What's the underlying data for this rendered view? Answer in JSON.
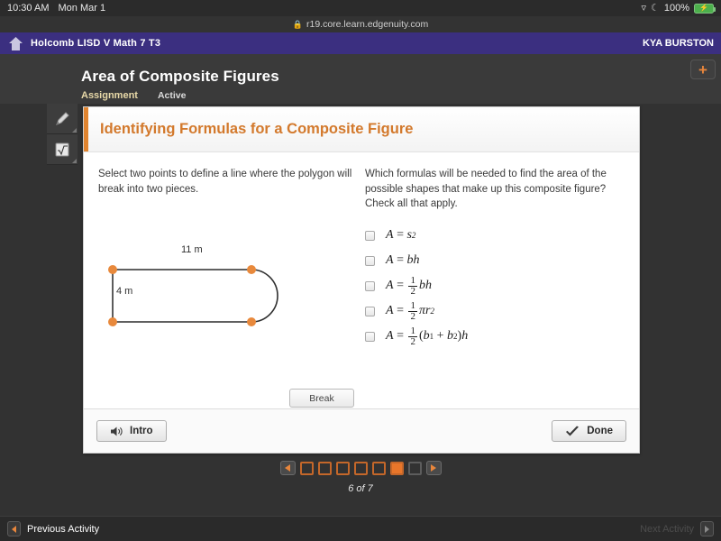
{
  "status_bar": {
    "time": "10:30 AM",
    "date": "Mon Mar 1",
    "wifi_icon": "wifi-icon",
    "dnd_icon": "moon-icon",
    "battery_percent": "100%",
    "battery_icon": "battery-charging-icon"
  },
  "browser": {
    "lock_icon": "lock-icon",
    "url": "r19.core.learn.edgenuity.com"
  },
  "nav": {
    "home_icon": "home-icon",
    "course": "Holcomb LISD V Math 7 T3",
    "user": "KYA BURSTON",
    "add_icon": "plus-icon"
  },
  "lesson": {
    "title": "Area of Composite Figures",
    "type_label": "Assignment",
    "status_label": "Active"
  },
  "tools": [
    {
      "name": "pencil-tool",
      "icon": "pencil-icon"
    },
    {
      "name": "math-tool",
      "icon": "square-root-icon"
    }
  ],
  "card": {
    "heading": "Identifying Formulas for a Composite Figure",
    "prompt_left": "Select two points to define a line where the polygon will break into two pieces.",
    "prompt_right": "Which formulas will be needed to find the area of the possible shapes that make up this composite figure? Check all that apply.",
    "break_button": "Break",
    "intro_button": "Intro",
    "intro_icon": "speaker-icon",
    "done_button": "Done",
    "done_icon": "check-icon"
  },
  "figure": {
    "top_label": "11 m",
    "left_label": "4 m",
    "vertex_color": "#e8893c",
    "line_color": "#4a4a4a",
    "vertex_count": 4
  },
  "answers": [
    {
      "id": "opt-square",
      "checked": false,
      "formula_text": "A = s2"
    },
    {
      "id": "opt-rectangle",
      "checked": false,
      "formula_text": "A = bh"
    },
    {
      "id": "opt-triangle",
      "checked": false,
      "formula_text": "A = 1/2 bh"
    },
    {
      "id": "opt-semicircle",
      "checked": false,
      "formula_text": "A = 1/2 pi r2"
    },
    {
      "id": "opt-trapezoid",
      "checked": false,
      "formula_text": "A = 1/2 (b1 + b2) h"
    }
  ],
  "pagination": {
    "prev_icon": "arrow-left-icon",
    "next_icon": "arrow-right-icon",
    "total": 7,
    "current": 6,
    "count_label": "6 of 7",
    "active_color": "#e8762a",
    "inactive_color": "#5d5d5d"
  },
  "bottom_bar": {
    "previous_label": "Previous Activity",
    "previous_icon": "arrow-left-icon",
    "next_label": "Next Activity",
    "next_icon": "arrow-right-icon",
    "next_disabled": true
  }
}
